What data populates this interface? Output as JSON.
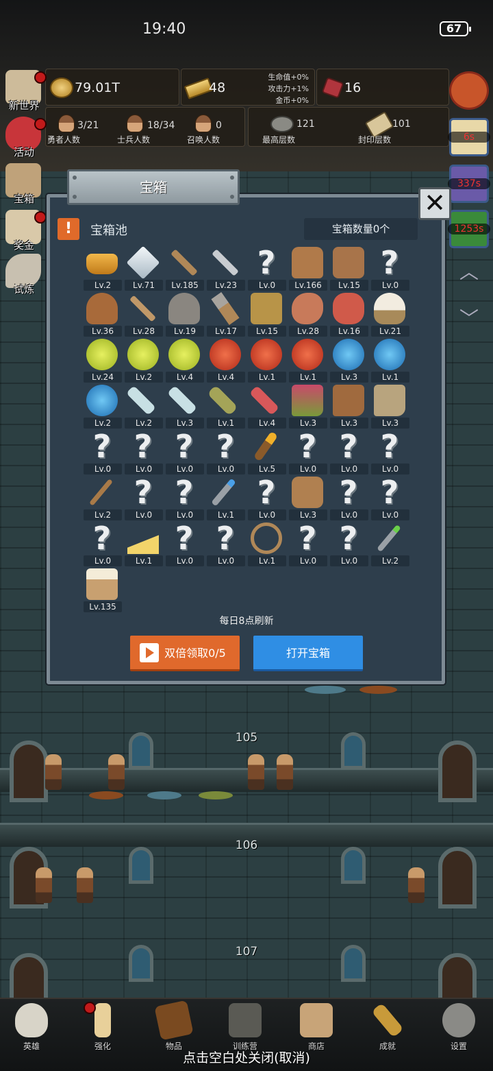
{
  "status": {
    "time": "19:40",
    "battery": "67"
  },
  "resources": {
    "gold": "79.01T",
    "bars": "48",
    "bonus_hp": "生命值+0%",
    "bonus_atk": "攻击力+1%",
    "bonus_gold": "金币+0%",
    "gems": "16"
  },
  "counts": [
    {
      "value": "3/21",
      "label": "勇者人数"
    },
    {
      "value": "18/34",
      "label": "士兵人数"
    },
    {
      "value": "0",
      "label": "召唤人数"
    },
    {
      "value": "121",
      "label": "最高层数"
    },
    {
      "value": "101",
      "label": "封印层数"
    }
  ],
  "side_menu": [
    "新世界",
    "活动",
    "宝箱",
    "奖金",
    "试炼"
  ],
  "timers": [
    "6s",
    "337s",
    "1253s"
  ],
  "dialog": {
    "title": "宝箱",
    "pool_label": "宝箱池",
    "pool_count": "宝箱数量0个",
    "refresh_note": "每日8点刷新",
    "double_button": "双倍领取0/5",
    "open_button": "打开宝箱",
    "items": [
      {
        "icon": "crown-icon",
        "lv": "Lv.2"
      },
      {
        "icon": "diamond-icon",
        "lv": "Lv.71"
      },
      {
        "icon": "wooden-sword-icon",
        "lv": "Lv.185"
      },
      {
        "icon": "steel-sword-icon",
        "lv": "Lv.23"
      },
      {
        "icon": "unknown-item-icon",
        "lv": "Lv.0"
      },
      {
        "icon": "backpack-icon",
        "lv": "Lv.166"
      },
      {
        "icon": "large-backpack-icon",
        "lv": "Lv.15"
      },
      {
        "icon": "unknown-item-icon",
        "lv": "Lv.0"
      },
      {
        "icon": "leather-helmet-icon",
        "lv": "Lv.36"
      },
      {
        "icon": "dagger-icon",
        "lv": "Lv.28"
      },
      {
        "icon": "knight-helmet-icon",
        "lv": "Lv.19"
      },
      {
        "icon": "hammer-icon",
        "lv": "Lv.17"
      },
      {
        "icon": "great-helm-icon",
        "lv": "Lv.15"
      },
      {
        "icon": "ham-icon",
        "lv": "Lv.28"
      },
      {
        "icon": "steak-icon",
        "lv": "Lv.16"
      },
      {
        "icon": "rice-bowl-icon",
        "lv": "Lv.21"
      },
      {
        "icon": "yellow-potion-icon",
        "lv": "Lv.24"
      },
      {
        "icon": "yellow-potion-icon",
        "lv": "Lv.2"
      },
      {
        "icon": "yellow-potion-icon",
        "lv": "Lv.4"
      },
      {
        "icon": "red-potion-icon",
        "lv": "Lv.4"
      },
      {
        "icon": "red-potion-icon",
        "lv": "Lv.1"
      },
      {
        "icon": "red-potion-icon",
        "lv": "Lv.1"
      },
      {
        "icon": "blue-potion-icon",
        "lv": "Lv.3"
      },
      {
        "icon": "blue-potion-icon",
        "lv": "Lv.1"
      },
      {
        "icon": "blue-potion-icon",
        "lv": "Lv.2"
      },
      {
        "icon": "clear-vial-icon",
        "lv": "Lv.2"
      },
      {
        "icon": "clear-vial-icon",
        "lv": "Lv.3"
      },
      {
        "icon": "olive-bottle-icon",
        "lv": "Lv.1"
      },
      {
        "icon": "red-vial-icon",
        "lv": "Lv.4"
      },
      {
        "icon": "winged-boot-icon",
        "lv": "Lv.3"
      },
      {
        "icon": "leather-boot-icon",
        "lv": "Lv.3"
      },
      {
        "icon": "cloth-boot-icon",
        "lv": "Lv.3"
      },
      {
        "icon": "unknown-item-icon",
        "lv": "Lv.0"
      },
      {
        "icon": "unknown-item-icon",
        "lv": "Lv.0"
      },
      {
        "icon": "unknown-item-icon",
        "lv": "Lv.0"
      },
      {
        "icon": "unknown-item-icon",
        "lv": "Lv.0"
      },
      {
        "icon": "torch-icon",
        "lv": "Lv.5"
      },
      {
        "icon": "unknown-item-icon",
        "lv": "Lv.0"
      },
      {
        "icon": "unknown-item-icon",
        "lv": "Lv.0"
      },
      {
        "icon": "unknown-item-icon",
        "lv": "Lv.0"
      },
      {
        "icon": "wooden-staff-icon",
        "lv": "Lv.2"
      },
      {
        "icon": "unknown-item-icon",
        "lv": "Lv.0"
      },
      {
        "icon": "unknown-item-icon",
        "lv": "Lv.0"
      },
      {
        "icon": "blue-scepter-icon",
        "lv": "Lv.1"
      },
      {
        "icon": "unknown-item-icon",
        "lv": "Lv.0"
      },
      {
        "icon": "travel-pack-icon",
        "lv": "Lv.3"
      },
      {
        "icon": "unknown-item-icon",
        "lv": "Lv.0"
      },
      {
        "icon": "unknown-item-icon",
        "lv": "Lv.0"
      },
      {
        "icon": "unknown-item-icon",
        "lv": "Lv.0"
      },
      {
        "icon": "cheese-icon",
        "lv": "Lv.1"
      },
      {
        "icon": "unknown-item-icon",
        "lv": "Lv.0"
      },
      {
        "icon": "unknown-item-icon",
        "lv": "Lv.0"
      },
      {
        "icon": "bow-icon",
        "lv": "Lv.1"
      },
      {
        "icon": "unknown-item-icon",
        "lv": "Lv.0"
      },
      {
        "icon": "unknown-item-icon",
        "lv": "Lv.0"
      },
      {
        "icon": "green-wand-icon",
        "lv": "Lv.2"
      },
      {
        "icon": "beer-mug-icon",
        "lv": "Lv.135"
      }
    ]
  },
  "floors": [
    "105",
    "106",
    "107"
  ],
  "bottom_nav": [
    "英雄",
    "强化",
    "物品",
    "训练营",
    "商店",
    "成就",
    "设置"
  ],
  "close_hint": "点击空白处关闭(取消)",
  "colors": {
    "accent_orange": "#e0692c",
    "accent_blue": "#2f8ee4",
    "dialog_bg": "#2e3e4c"
  }
}
